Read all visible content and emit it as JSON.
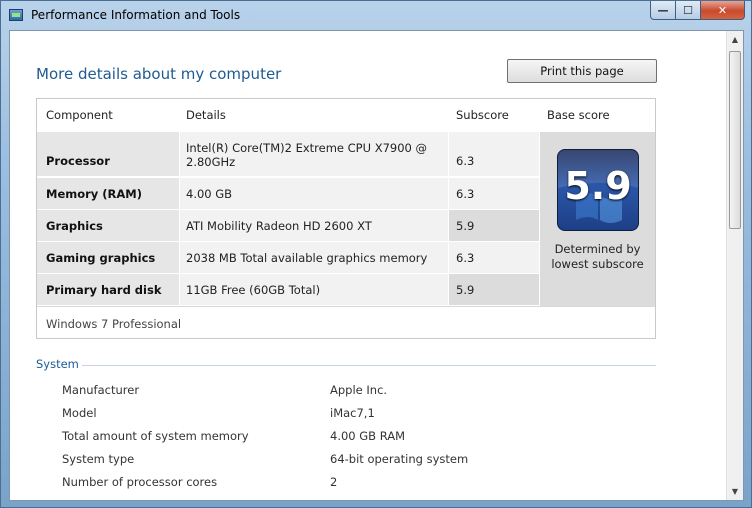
{
  "window": {
    "title": "Performance Information and Tools",
    "minimize": "—",
    "maximize": "☐",
    "close": "✕"
  },
  "page": {
    "heading": "More details about my computer",
    "print_label": "Print this page"
  },
  "score_table": {
    "headers": {
      "component": "Component",
      "details": "Details",
      "subscore": "Subscore",
      "base": "Base score"
    },
    "rows": [
      {
        "component": "Processor",
        "details": "Intel(R) Core(TM)2 Extreme CPU X7900 @ 2.80GHz",
        "subscore": "6.3"
      },
      {
        "component": "Memory (RAM)",
        "details": "4.00 GB",
        "subscore": "6.3"
      },
      {
        "component": "Graphics",
        "details": "ATI Mobility Radeon HD 2600 XT",
        "subscore": "5.9"
      },
      {
        "component": "Gaming graphics",
        "details": "2038 MB Total available graphics memory",
        "subscore": "6.3"
      },
      {
        "component": "Primary hard disk",
        "details": "11GB Free (60GB Total)",
        "subscore": "5.9"
      }
    ],
    "base_score": "5.9",
    "base_note": "Determined by lowest subscore",
    "edition": "Windows 7 Professional"
  },
  "system": {
    "title": "System",
    "rows": [
      {
        "label": "Manufacturer",
        "value": "Apple Inc."
      },
      {
        "label": "Model",
        "value": "iMac7,1"
      },
      {
        "label": "Total amount of system memory",
        "value": "4.00 GB RAM"
      },
      {
        "label": "System type",
        "value": "64-bit operating system"
      },
      {
        "label": "Number of processor cores",
        "value": "2"
      }
    ]
  },
  "colors": {
    "accent": "#1e5b92",
    "close_button": "#c74a2e"
  },
  "icons": {
    "app": "performance-tools-icon",
    "badge": "windows-experience-index-badge"
  }
}
